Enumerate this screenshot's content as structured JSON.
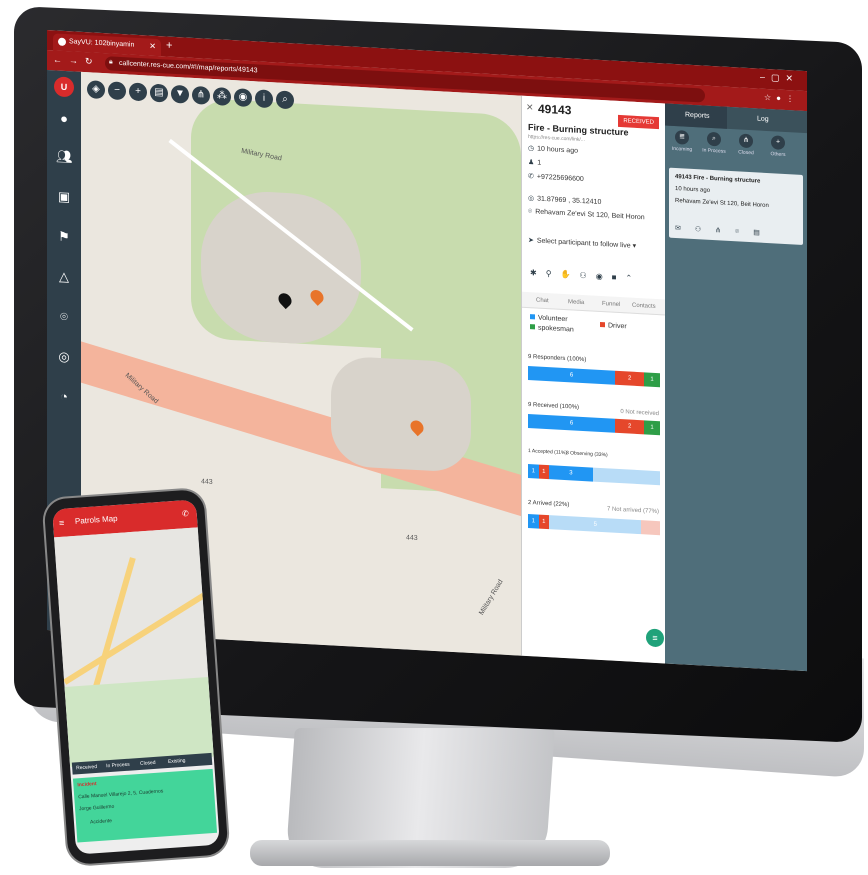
{
  "browser": {
    "tab_title": "SayVU: 102binyamin",
    "url": "callcenter.res-cue.com/#!/map/reports/49143"
  },
  "app": {
    "logo": "U",
    "nav_icons": [
      "user-icon",
      "users-icon",
      "alert-message-icon",
      "flag-icon",
      "shapes-icon",
      "location-pin-icon",
      "beacon-icon",
      "pie-chart-icon"
    ],
    "map_tools": [
      "layers-icon",
      "zoom-out-icon",
      "zoom-in-icon",
      "map-icon",
      "filter-icon",
      "hierarchy-icon",
      "group-icon",
      "visibility-icon",
      "info-icon",
      "search-icon"
    ]
  },
  "map": {
    "labels": [
      "Military Road",
      "Military Road",
      "Military Road",
      "443",
      "443"
    ]
  },
  "report": {
    "id": "49143",
    "title": "Fire - Burning structure",
    "status": "RECEIVED",
    "link": "https://res-cue.com/link/...",
    "time_ago": "10 hours ago",
    "responders": "1",
    "phone": "+97225696600",
    "coords": "31.87969 , 35.12410",
    "address": "Rehavam Ze'evi St 120, Beit Horon",
    "follow_placeholder": "Select participant to follow live",
    "sub_tabs": [
      "Chat",
      "Media",
      "Funnel",
      "Contacts"
    ],
    "legend": {
      "volunteer": "Volunteer",
      "driver": "Driver",
      "spokesman": "spokesman"
    },
    "responders_title": "9 Responders (100%)",
    "responders_bar": [
      "6",
      "2",
      "1"
    ],
    "received_title": "9 Received (100%)",
    "received_right": "0 Not received",
    "received_bar": [
      "6",
      "2",
      "1"
    ],
    "accepted_title": "1 Accepted (11%)",
    "observing_title": "3 Observing (33%)",
    "accepted_bar": [
      "1",
      "1",
      "3"
    ],
    "arrived_title": "2 Arrived (22%)",
    "arrived_right": "7 Not arrived (77%)",
    "arrived_bar": [
      "1",
      "1",
      "5"
    ]
  },
  "reports_panel": {
    "tab_reports": "Reports",
    "tab_log": "Log",
    "filters": [
      "Incoming",
      "In Process",
      "Closed",
      "Others"
    ],
    "card_title": "49143 Fire - Burning structure",
    "card_time": "10 hours ago",
    "card_address": "Rehavam Ze'evi St 120, Beit Horon"
  },
  "phone": {
    "title": "Patrols Map",
    "tabs": [
      "Received",
      "In Process",
      "Closed",
      "Existing"
    ],
    "card_lines": [
      "Incident",
      "Calle Manuel Villarejo 2, 5, Cuadernos",
      "Jorge Guillermo",
      "Accidente"
    ]
  },
  "colors": {
    "brand_red": "#d92b2b",
    "nav_dark": "#2f3f4a",
    "blue": "#2196f3",
    "red": "#e5472b",
    "green": "#2e9e47",
    "teal_fab": "#20a27a"
  }
}
